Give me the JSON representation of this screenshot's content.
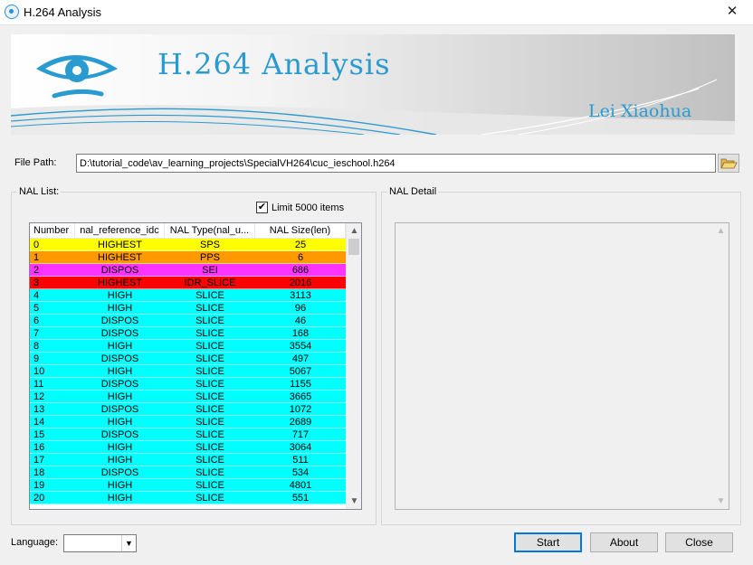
{
  "window": {
    "title": "H.264 Analysis",
    "close_glyph": "✕"
  },
  "banner": {
    "title": "H.264 Analysis",
    "author": "Lei Xiaohua"
  },
  "file_path": {
    "label": "File Path:",
    "value": "D:\\tutorial_code\\av_learning_projects\\SpecialVH264\\cuc_ieschool.h264",
    "browse_icon": "folder-open-icon"
  },
  "nal_list": {
    "group_title": "NAL List:",
    "limit_label": "Limit 5000 items",
    "limit_checked": true,
    "check_glyph": "✔",
    "columns": [
      "Number",
      "nal_reference_idc",
      "NAL Type(nal_u...",
      "NAL Size(len)"
    ],
    "rows": [
      {
        "num": "0",
        "ref": "HIGHEST",
        "type": "SPS",
        "size": "25",
        "color": "#ffff00"
      },
      {
        "num": "1",
        "ref": "HIGHEST",
        "type": "PPS",
        "size": "6",
        "color": "#ff9900"
      },
      {
        "num": "2",
        "ref": "DISPOS",
        "type": "SEI",
        "size": "686",
        "color": "#ff33ff"
      },
      {
        "num": "3",
        "ref": "HIGHEST",
        "type": "IDR_SLICE",
        "size": "2016",
        "color": "#ff0000"
      },
      {
        "num": "4",
        "ref": "HIGH",
        "type": "SLICE",
        "size": "3113",
        "color": "#00ffff"
      },
      {
        "num": "5",
        "ref": "HIGH",
        "type": "SLICE",
        "size": "96",
        "color": "#00ffff"
      },
      {
        "num": "6",
        "ref": "DISPOS",
        "type": "SLICE",
        "size": "46",
        "color": "#00ffff"
      },
      {
        "num": "7",
        "ref": "DISPOS",
        "type": "SLICE",
        "size": "168",
        "color": "#00ffff"
      },
      {
        "num": "8",
        "ref": "HIGH",
        "type": "SLICE",
        "size": "3554",
        "color": "#00ffff"
      },
      {
        "num": "9",
        "ref": "DISPOS",
        "type": "SLICE",
        "size": "497",
        "color": "#00ffff"
      },
      {
        "num": "10",
        "ref": "HIGH",
        "type": "SLICE",
        "size": "5067",
        "color": "#00ffff"
      },
      {
        "num": "11",
        "ref": "DISPOS",
        "type": "SLICE",
        "size": "1155",
        "color": "#00ffff"
      },
      {
        "num": "12",
        "ref": "HIGH",
        "type": "SLICE",
        "size": "3665",
        "color": "#00ffff"
      },
      {
        "num": "13",
        "ref": "DISPOS",
        "type": "SLICE",
        "size": "1072",
        "color": "#00ffff"
      },
      {
        "num": "14",
        "ref": "HIGH",
        "type": "SLICE",
        "size": "2689",
        "color": "#00ffff"
      },
      {
        "num": "15",
        "ref": "DISPOS",
        "type": "SLICE",
        "size": "717",
        "color": "#00ffff"
      },
      {
        "num": "16",
        "ref": "HIGH",
        "type": "SLICE",
        "size": "3064",
        "color": "#00ffff"
      },
      {
        "num": "17",
        "ref": "HIGH",
        "type": "SLICE",
        "size": "511",
        "color": "#00ffff"
      },
      {
        "num": "18",
        "ref": "DISPOS",
        "type": "SLICE",
        "size": "534",
        "color": "#00ffff"
      },
      {
        "num": "19",
        "ref": "HIGH",
        "type": "SLICE",
        "size": "4801",
        "color": "#00ffff"
      },
      {
        "num": "20",
        "ref": "HIGH",
        "type": "SLICE",
        "size": "551",
        "color": "#00ffff"
      }
    ]
  },
  "nal_detail": {
    "group_title": "NAL Detail"
  },
  "language": {
    "label": "Language:",
    "value": ""
  },
  "buttons": {
    "start": "Start",
    "about": "About",
    "close": "Close"
  },
  "colors": {
    "accent": "#2a9bd0",
    "sps": "#ffff00",
    "pps": "#ff9900",
    "sei": "#ff33ff",
    "idr": "#ff0000",
    "slice": "#00ffff"
  }
}
